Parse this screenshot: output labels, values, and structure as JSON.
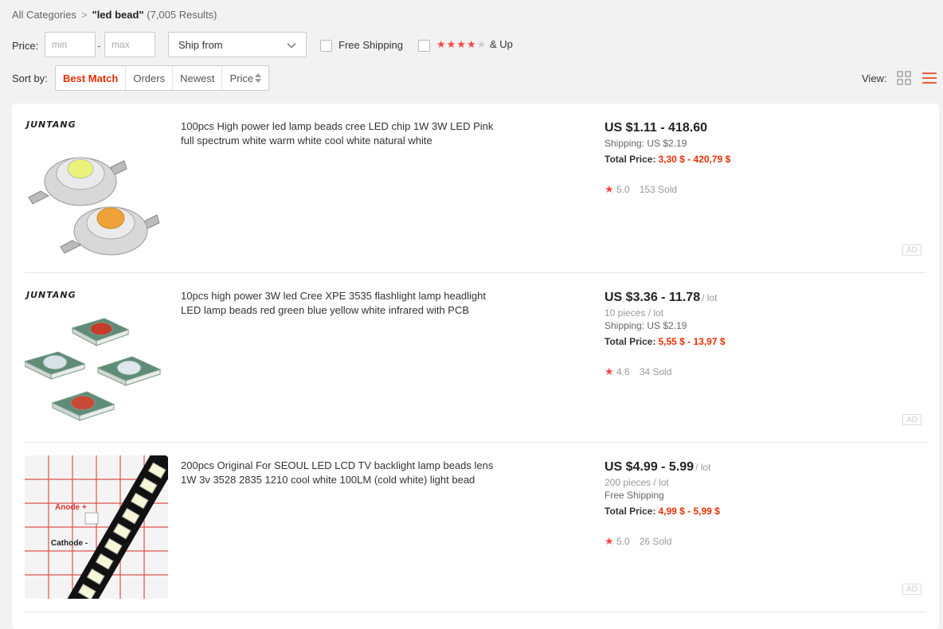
{
  "breadcrumb": {
    "root": "All Categories",
    "separator": ">",
    "query": "\"led bead\"",
    "count": "(7,005 Results)"
  },
  "filters": {
    "price_label": "Price:",
    "min_placeholder": "min",
    "dash": "-",
    "max_placeholder": "max",
    "ship_from": "Ship from",
    "free_shipping": "Free Shipping",
    "rating_stars": 4,
    "rating_suffix": "& Up"
  },
  "sort": {
    "label": "Sort by:",
    "options": [
      "Best Match",
      "Orders",
      "Newest",
      "Price"
    ],
    "active": "Best Match"
  },
  "view": {
    "label": "View:",
    "modes": [
      "grid-icon",
      "list-icon"
    ],
    "active": "list-icon"
  },
  "colors": {
    "accent": "#e62e04",
    "star": "#ff4444"
  },
  "products": [
    {
      "brand": "JUNTANG",
      "title": "100pcs High power led lamp beads cree LED chip 1W 3W LED Pink full spectrum white warm white cool white natural white",
      "price": "US $1.11 - 418.60",
      "unit": "",
      "pieces": "",
      "shipping": "Shipping: US $2.19",
      "total_label": "Total Price:",
      "total_value": "3,30 $ - 420,79 $",
      "rating": "5.0",
      "sold": "153 Sold",
      "ad": "AD"
    },
    {
      "brand": "JUNTANG",
      "title": "10pcs high power 3W led Cree XPE 3535 flashlight lamp headlight LED lamp beads red green blue yellow white infrared with PCB",
      "price": "US $3.36 - 11.78",
      "unit": "/ lot",
      "pieces": "10 pieces / lot",
      "shipping": "Shipping: US $2.19",
      "total_label": "Total Price:",
      "total_value": "5,55 $ - 13,97 $",
      "rating": "4.6",
      "sold": "34 Sold",
      "ad": "AD"
    },
    {
      "brand": "",
      "title": "200pcs Original For SEOUL LED LCD TV backlight lamp beads lens 1W 3v 3528 2835 1210 cool white 100LM (cold white) light bead",
      "price": "US $4.99 - 5.99",
      "unit": "/ lot",
      "pieces": "200 pieces / lot",
      "shipping": "Free Shipping",
      "total_label": "Total Price:",
      "total_value": "4,99 $ - 5,99 $",
      "rating": "5.0",
      "sold": "26 Sold",
      "ad": "AD",
      "image_text": {
        "anode": "Anode +",
        "cathode": "Cathode -"
      }
    }
  ]
}
